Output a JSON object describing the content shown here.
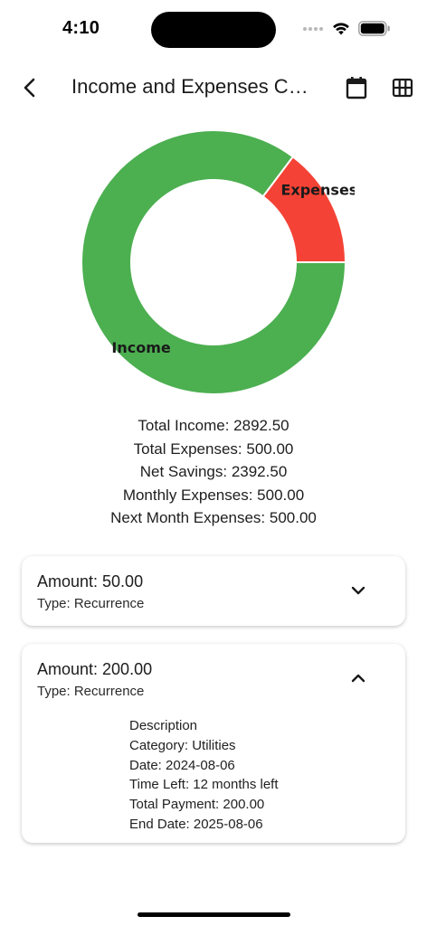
{
  "status_bar": {
    "time": "4:10"
  },
  "app_bar": {
    "title": "Income and Expenses Chart",
    "icons": {
      "back": "chevron-left-icon",
      "calendar": "calendar-icon",
      "table": "table-grid-icon"
    }
  },
  "chart_data": {
    "type": "pie",
    "donut": true,
    "labels": [
      "Income",
      "Expenses"
    ],
    "values": [
      2892.5,
      500.0
    ],
    "colors": [
      "#4caf50",
      "#f44336"
    ]
  },
  "summary": {
    "total_income": "Total Income: 2892.50",
    "total_expenses": "Total Expenses: 500.00",
    "net_savings": "Net Savings: 2392.50",
    "monthly_expenses": "Monthly Expenses: 500.00",
    "next_month_expenses": "Next Month Expenses: 500.00"
  },
  "transactions": [
    {
      "amount": "Amount: 50.00",
      "type": "Type: Recurrence",
      "expanded": false,
      "toggle_icon": "chevron-down-icon"
    },
    {
      "amount": "Amount: 200.00",
      "type": "Type: Recurrence",
      "expanded": true,
      "toggle_icon": "chevron-up-icon",
      "details": {
        "description": "Description",
        "category": "Category: Utilities",
        "date": "Date: 2024-08-06",
        "time_left": "Time Left: 12 months left",
        "total_payment": "Total Payment: 200.00",
        "end_date": "End Date: 2025-08-06"
      }
    }
  ]
}
